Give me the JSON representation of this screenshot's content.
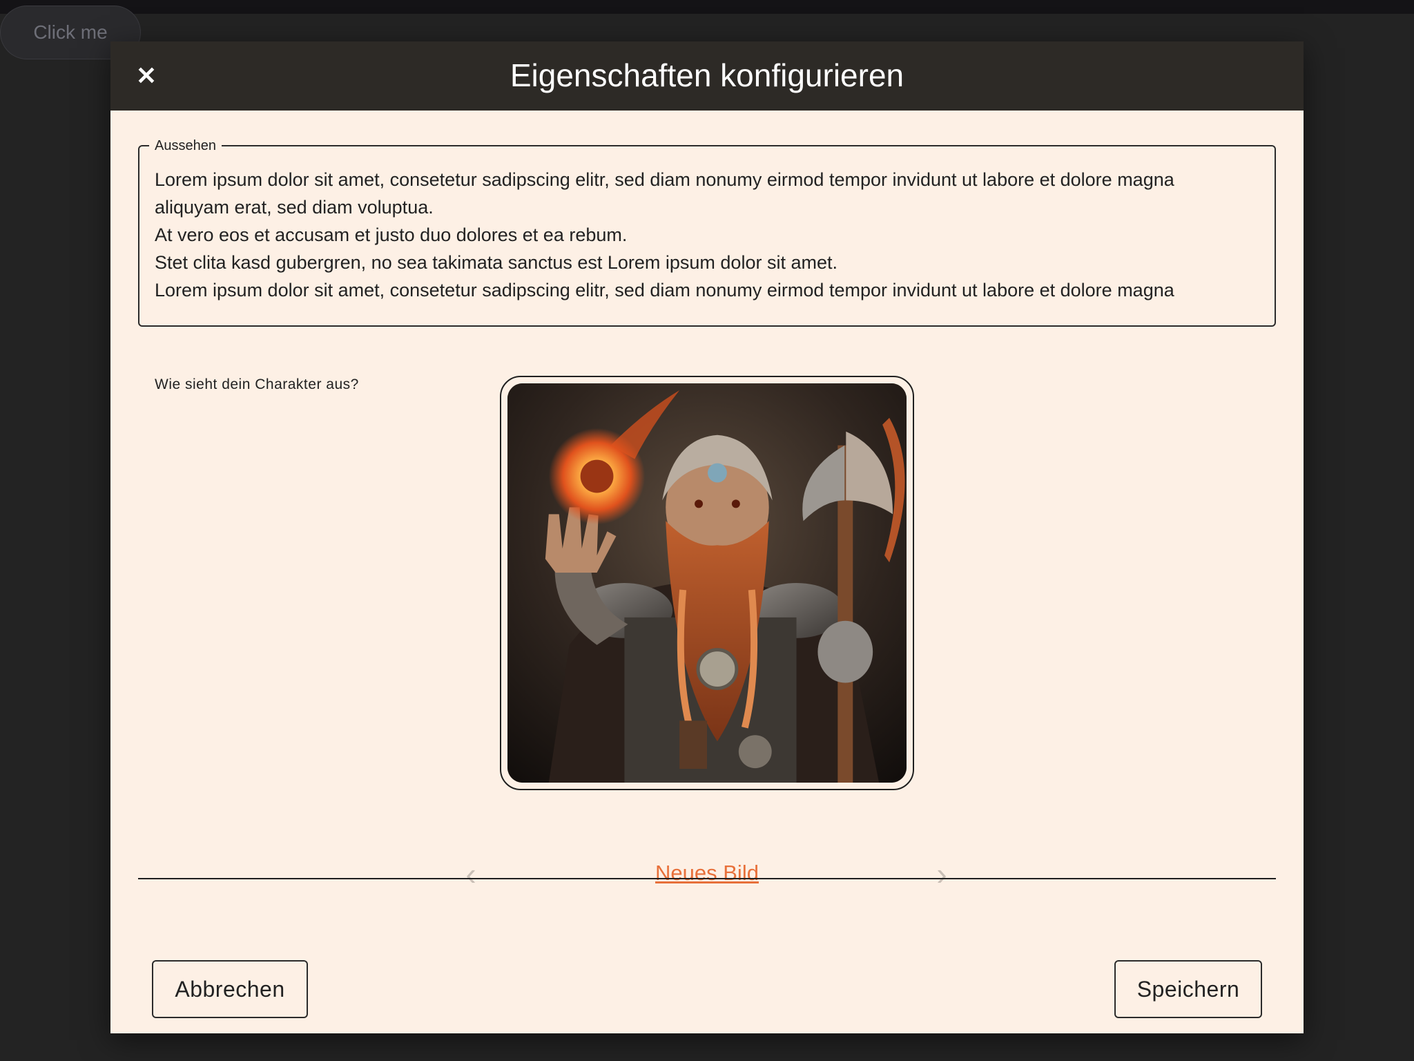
{
  "background": {
    "button_label": "Click me"
  },
  "modal": {
    "title": "Eigenschaften konfigurieren",
    "close_icon": "close-icon"
  },
  "appearance": {
    "legend": "Aussehen",
    "text": "Lorem ipsum dolor sit amet, consetetur sadipscing elitr, sed diam nonumy eirmod tempor invidunt ut labore et dolore magna aliquyam erat, sed diam voluptua.\nAt vero eos et accusam et justo duo dolores et ea rebum.\nStet clita kasd gubergren, no sea takimata sanctus est Lorem ipsum dolor sit amet.\nLorem ipsum dolor sit amet, consetetur sadipscing elitr, sed diam nonumy eirmod tempor invidunt ut labore et dolore magna",
    "helper": "Wie sieht dein Charakter aus?"
  },
  "image": {
    "prev_icon": "chevron-left-icon",
    "next_icon": "chevron-right-icon",
    "new_image_label": "Neues Bild"
  },
  "actions": {
    "cancel_label": "Abbrechen",
    "save_label": "Speichern"
  },
  "colors": {
    "page_bg": "#232323",
    "header_bg": "#2d2a26",
    "modal_bg": "#fdf0e5",
    "link": "#e8703a"
  }
}
